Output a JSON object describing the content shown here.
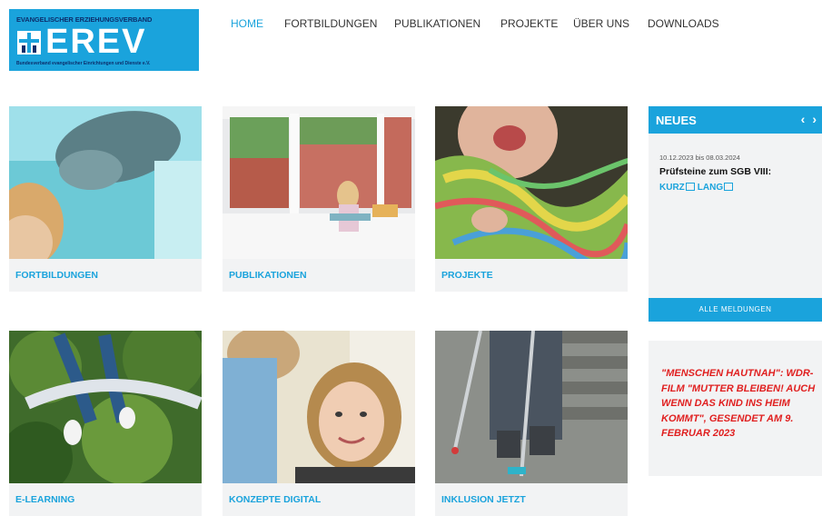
{
  "logo": {
    "org_line": "EVANGELISCHER ERZIEHUNGSVERBAND",
    "word": "EREV",
    "tagline": "Bundesverband evangelischer Einrichtungen und Dienste e.V."
  },
  "nav": {
    "items": [
      {
        "label": "HOME",
        "active": true
      },
      {
        "label": "FORTBILDUNGEN"
      },
      {
        "label": "PUBLIKATIONEN"
      },
      {
        "label": "PROJEKTE"
      },
      {
        "label": "ÜBER UNS"
      },
      {
        "label": "DOWNLOADS"
      }
    ]
  },
  "tiles": [
    {
      "label": "FORTBILDUNGEN",
      "image": "photo-child-aquarium-dolphin"
    },
    {
      "label": "PUBLIKATIONEN",
      "image": "photo-girl-reading-window"
    },
    {
      "label": "PROJEKTE",
      "image": "photo-child-paper-streamers"
    },
    {
      "label": "E-LEARNING",
      "image": "photo-child-jumping-trees"
    },
    {
      "label": "KONZEPTE DIGITAL",
      "image": "photo-woman-child-smiling"
    },
    {
      "label": "INKLUSION JETZT",
      "image": "photo-legs-crutches-stairs"
    }
  ],
  "news": {
    "header": "NEUES",
    "prev_icon": "chevron-left-icon",
    "next_icon": "chevron-right-icon",
    "item": {
      "date": "10.12.2023 bis 08.03.2024",
      "title": "Prüfsteine zum SGB VIII:",
      "link_short": "KURZ",
      "link_long": "LANG"
    },
    "all_button": "ALLE MELDUNGEN"
  },
  "promo": {
    "text": "\"MENSCHEN HAUTNAH\": WDR-FILM \"MUTTER BLEIBEN! AUCH WENN DAS KIND INS HEIM KOMMT\", GESENDET AM 9. FEBRUAR 2023"
  },
  "colors": {
    "accent": "#1aa3dc",
    "logo_text": "#0c2e6b",
    "promo_text": "#e02020",
    "panel_bg": "#f2f3f4"
  }
}
